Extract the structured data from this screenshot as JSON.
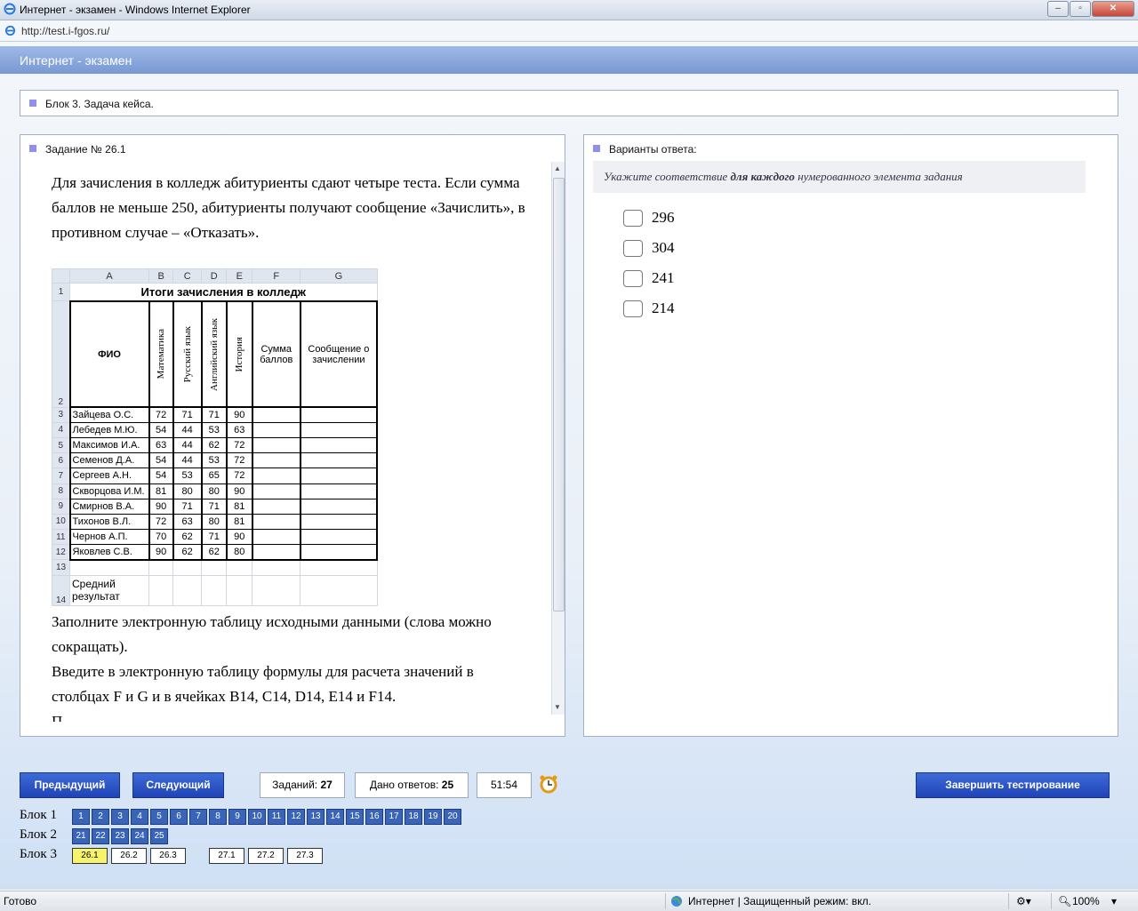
{
  "window": {
    "title": "Интернет - экзамен - Windows Internet Explorer",
    "url": "http://test.i-fgos.ru/"
  },
  "exam": {
    "header": "Интернет - экзамен",
    "block_title": "Блок 3. Задача кейса."
  },
  "task": {
    "title": "Задание № 26.1",
    "intro": "Для зачисления в колледж абитуриенты сдают четыре теста. Если сумма баллов не меньше 250, абитуриенты получают сообщение «Зачислить», в противном случае – «Отказать».",
    "instructions_1": "Заполните электронную таблицу исходными данными (слова можно сокращать).",
    "instructions_2": "Введите в электронную таблицу формулы для расчета значений в столбцах F и G и в ячейках B14, C14, D14, E14 и F14.",
    "trailing": "П..."
  },
  "sheet": {
    "col_headers": [
      "A",
      "B",
      "C",
      "D",
      "E",
      "F",
      "G"
    ],
    "title": "Итоги зачисления в колледж",
    "headers": {
      "fio": "ФИО",
      "math": "Математика",
      "rus": "Русский язык",
      "eng": "Английский язык",
      "hist": "История",
      "sum": "Сумма баллов",
      "msg": "Сообщение о зачислении"
    },
    "row_numbers": {
      "r1": "1",
      "r2": "2",
      "r13": "13",
      "r14": "14"
    },
    "avg_label": "Средний результат",
    "rows": [
      {
        "n": "3",
        "name": "Зайцева О.С.",
        "b": "72",
        "c": "71",
        "d": "71",
        "e": "90"
      },
      {
        "n": "4",
        "name": "Лебедев М.Ю.",
        "b": "54",
        "c": "44",
        "d": "53",
        "e": "63"
      },
      {
        "n": "5",
        "name": "Максимов И.А.",
        "b": "63",
        "c": "44",
        "d": "62",
        "e": "72"
      },
      {
        "n": "6",
        "name": "Семенов Д.А.",
        "b": "54",
        "c": "44",
        "d": "53",
        "e": "72"
      },
      {
        "n": "7",
        "name": "Сергеев А.Н.",
        "b": "54",
        "c": "53",
        "d": "65",
        "e": "72"
      },
      {
        "n": "8",
        "name": "Скворцова И.М.",
        "b": "81",
        "c": "80",
        "d": "80",
        "e": "90"
      },
      {
        "n": "9",
        "name": "Смирнов В.А.",
        "b": "90",
        "c": "71",
        "d": "71",
        "e": "81"
      },
      {
        "n": "10",
        "name": "Тихонов В.Л.",
        "b": "72",
        "c": "63",
        "d": "80",
        "e": "81"
      },
      {
        "n": "11",
        "name": "Чернов А.П.",
        "b": "70",
        "c": "62",
        "d": "71",
        "e": "90"
      },
      {
        "n": "12",
        "name": "Яковлев С.В.",
        "b": "90",
        "c": "62",
        "d": "62",
        "e": "80"
      }
    ]
  },
  "answers": {
    "title": "Варианты ответа:",
    "hint_pre": "Укажите соответствие ",
    "hint_bold": "для каждого",
    "hint_post": " нумерованного элемента задания",
    "options": [
      "296",
      "304",
      "241",
      "214"
    ]
  },
  "controls": {
    "prev": "Предыдущий",
    "next": "Следующий",
    "tasks_label": "Заданий:",
    "tasks_value": "27",
    "answered_label": "Дано ответов:",
    "answered_value": "25",
    "timer": "51:54",
    "finish": "Завершить тестирование"
  },
  "blocks": {
    "b1_label": "Блок 1",
    "b2_label": "Блок 2",
    "b3_label": "Блок 3",
    "b1": [
      "1",
      "2",
      "3",
      "4",
      "5",
      "6",
      "7",
      "8",
      "9",
      "10",
      "11",
      "12",
      "13",
      "14",
      "15",
      "16",
      "17",
      "18",
      "19",
      "20"
    ],
    "b2": [
      "21",
      "22",
      "23",
      "24",
      "25"
    ],
    "b3a": [
      "26.1",
      "26.2",
      "26.3"
    ],
    "b3b": [
      "27.1",
      "27.2",
      "27.3"
    ]
  },
  "status": {
    "left": "Готово",
    "zone": "Интернет | Защищенный режим: вкл.",
    "zoom": "100%"
  },
  "colors": {
    "accent": "#2a4fc1",
    "header": "#7f9fd8",
    "current_task": "#f6f46a"
  }
}
